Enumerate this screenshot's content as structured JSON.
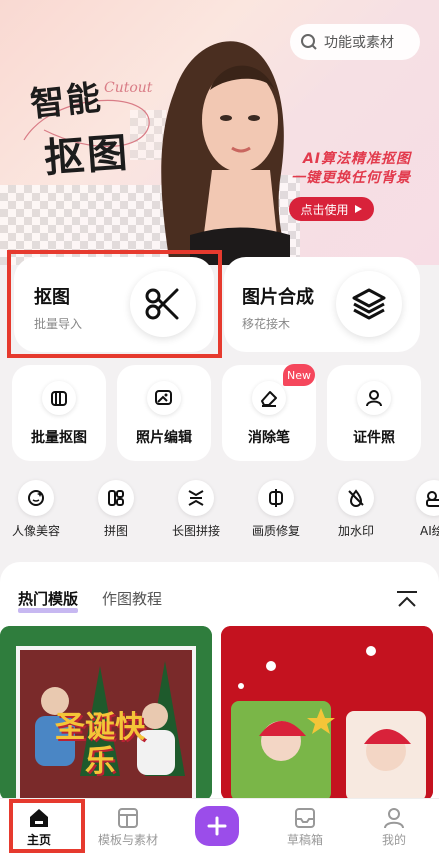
{
  "search": {
    "placeholder": "功能或素材"
  },
  "banner": {
    "title_line1": "智能",
    "title_line2": "抠图",
    "script_word": "Cutout",
    "tagline_line1": "AI算法精准抠图",
    "tagline_line2": "一键更换任何背景",
    "cta_label": "点击使用"
  },
  "feature_cards": [
    {
      "title": "抠图",
      "subtitle": "批量导入",
      "icon": "scissors-icon"
    },
    {
      "title": "图片合成",
      "subtitle": "移花接木",
      "icon": "layers-icon"
    }
  ],
  "tiles": [
    {
      "label": "批量抠图",
      "icon": "batch-cutout-icon"
    },
    {
      "label": "照片编辑",
      "icon": "photo-edit-icon"
    },
    {
      "label": "消除笔",
      "icon": "eraser-icon",
      "badge": "New"
    },
    {
      "label": "证件照",
      "icon": "id-photo-icon"
    }
  ],
  "tools": [
    {
      "label": "人像美容",
      "icon": "face-beauty-icon"
    },
    {
      "label": "拼图",
      "icon": "collage-icon"
    },
    {
      "label": "长图拼接",
      "icon": "long-stitch-icon"
    },
    {
      "label": "画质修复",
      "icon": "quality-repair-icon"
    },
    {
      "label": "加水印",
      "icon": "watermark-icon"
    },
    {
      "label": "AI绘",
      "icon": "ai-art-icon"
    }
  ],
  "content_tabs": {
    "active": "热门模版",
    "other": "作图教程"
  },
  "templates": [
    {
      "overlay_text": "圣诞快乐"
    },
    {
      "overlay_text": ""
    }
  ],
  "bottom_nav": [
    {
      "label": "主页",
      "icon": "home-icon",
      "active": true
    },
    {
      "label": "模板与素材",
      "icon": "template-icon"
    },
    {
      "label": "",
      "icon": "plus-icon"
    },
    {
      "label": "草稿箱",
      "icon": "drafts-icon"
    },
    {
      "label": "我的",
      "icon": "profile-icon"
    }
  ],
  "colors": {
    "accent": "#e63a2e",
    "cta": "#d8223a",
    "plus": "#9b4dea",
    "new_badge": "#f5475c"
  }
}
